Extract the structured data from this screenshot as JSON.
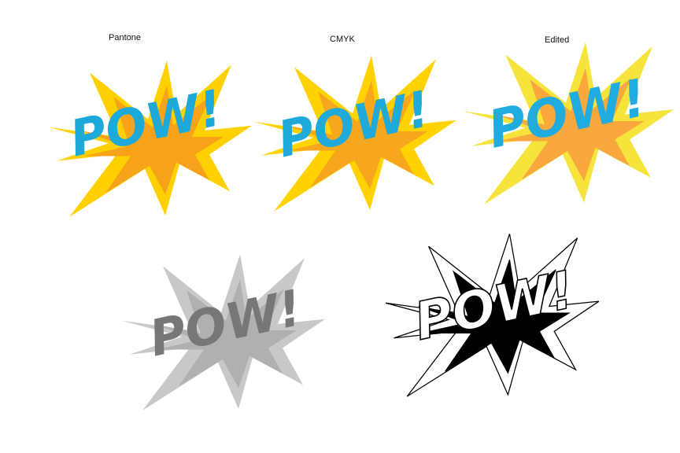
{
  "labels": {
    "pantone": "Pantone",
    "cmyk": "CMYK",
    "edited": "Edited"
  },
  "burst_text": "POW!",
  "versions": {
    "pantone": {
      "outer": "#FFD000",
      "inner": "#F7A21B",
      "text": "#1DA9DA"
    },
    "cmyk": {
      "outer": "#FFD200",
      "inner": "#F7A71E",
      "text": "#1FAAD9"
    },
    "edited": {
      "outer": "#F6E43C",
      "inner": "#F8A83C",
      "text": "#21ACDF"
    },
    "grayscale": {
      "outer": "#C8C8C8",
      "inner": "#B0B0B0",
      "text": "#777777"
    },
    "lineart": {
      "outer": "#FFFFFF",
      "inner": "#000000",
      "text": "#FFFFFF",
      "stroke": "#000000"
    }
  }
}
